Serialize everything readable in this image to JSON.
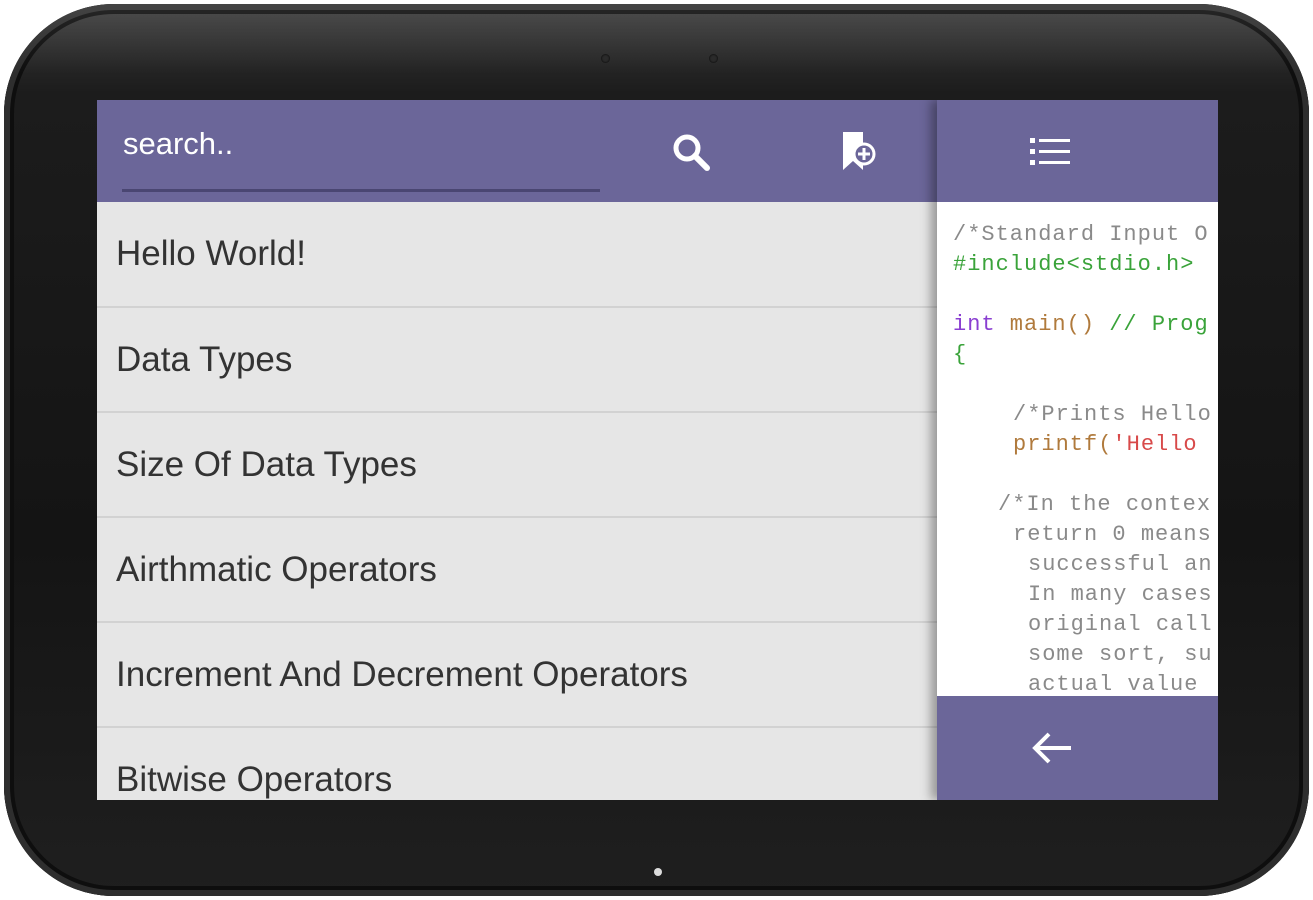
{
  "search": {
    "placeholder": "search.."
  },
  "icons": {
    "search": "search-icon",
    "bookmark": "bookmark-add-icon",
    "list": "list-icon",
    "back": "arrow-left-icon"
  },
  "colors": {
    "toolbar": "#6b6699",
    "list_background": "#e6e6e6",
    "item_text": "#333333",
    "comment": "#8a8a8a",
    "preprocessor": "#3aa33a",
    "keyword": "#8a3fd1",
    "function": "#b07a3c",
    "string": "#d84a4a"
  },
  "topics": [
    {
      "label": "Hello World!"
    },
    {
      "label": "Data Types"
    },
    {
      "label": "Size Of Data Types"
    },
    {
      "label": "Airthmatic Operators"
    },
    {
      "label": "Increment And Decrement Operators"
    },
    {
      "label": "Bitwise Operators"
    }
  ],
  "code": {
    "line1": "/*Standard Input O",
    "line2": "#include<stdio.h>",
    "line3_kw": "int",
    "line3_fn": " main()",
    "line3_comment": " // Prog",
    "line4": "{",
    "line5": "/*Prints Hello",
    "line6_fn": "printf(",
    "line6_str": "'Hello",
    "line7": "/*In the contex",
    "line8": "return 0 means",
    "line9": "successful an",
    "line10": "In many cases",
    "line11": "original call",
    "line12": "some sort, su",
    "line13": "actual value"
  }
}
